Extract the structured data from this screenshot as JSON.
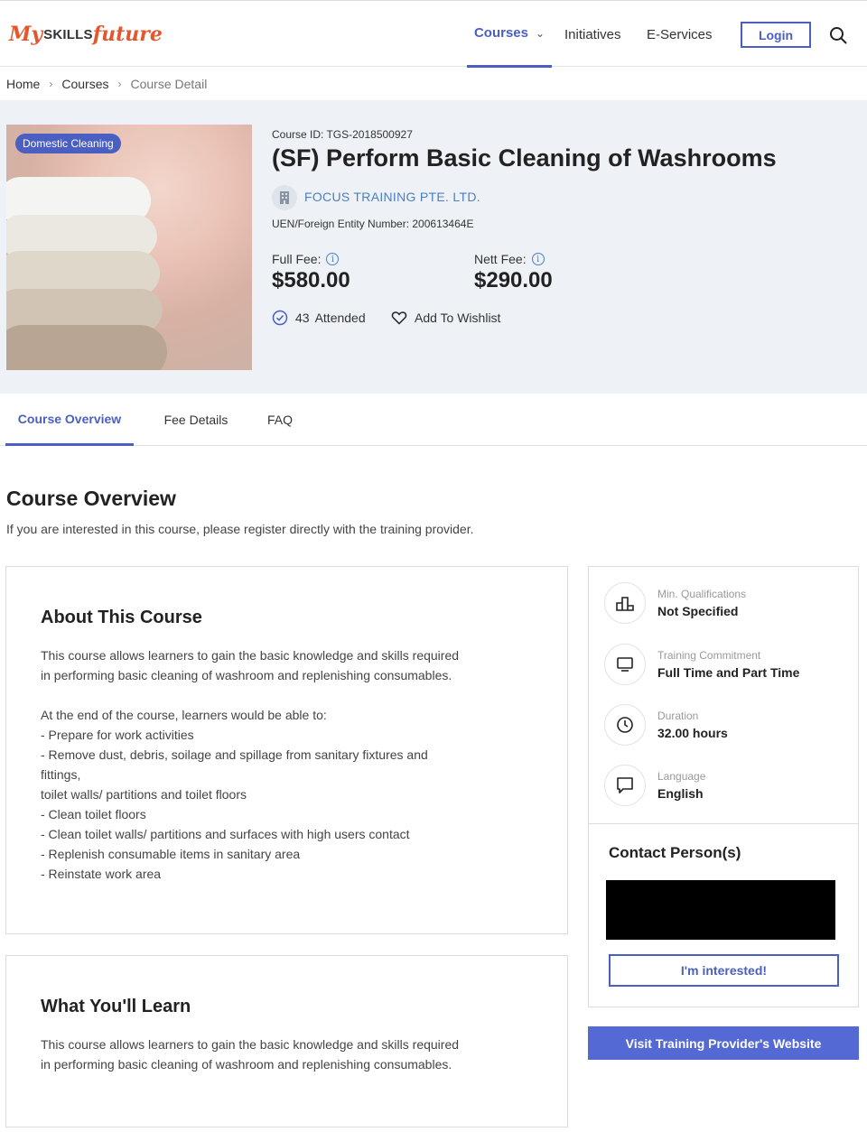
{
  "header": {
    "logo": {
      "my": "My",
      "skills": "SKILLS",
      "future": "future"
    },
    "nav": {
      "courses": "Courses",
      "initiatives": "Initiatives",
      "eservices": "E-Services"
    },
    "login": "Login"
  },
  "breadcrumb": {
    "home": "Home",
    "courses": "Courses",
    "current": "Course Detail"
  },
  "course": {
    "category": "Domestic Cleaning",
    "id_line": "Course ID: TGS-2018500927",
    "title": "(SF) Perform Basic Cleaning of Washrooms",
    "provider": "FOCUS TRAINING PTE. LTD.",
    "uen_line": "UEN/Foreign Entity Number: 200613464E",
    "full_fee_label": "Full Fee:",
    "full_fee": "$580.00",
    "nett_fee_label": "Nett Fee:",
    "nett_fee": "$290.00",
    "attended_count": "43",
    "attended_label": "Attended",
    "wishlist_label": "Add To Wishlist"
  },
  "tabs": {
    "overview": "Course Overview",
    "fee": "Fee Details",
    "faq": "FAQ"
  },
  "overview": {
    "title": "Course Overview",
    "subtitle": "If you are interested in this course, please register directly with the training provider.",
    "about_title": "About This Course",
    "about_body": "This course allows learners to gain the basic knowledge and skills required\nin performing basic cleaning of washroom and replenishing consumables.\n\nAt the end of the course, learners would be able to:\n- Prepare for work activities\n- Remove dust, debris, soilage and spillage from sanitary fixtures and\nfittings,\n   toilet walls/ partitions and toilet floors\n- Clean toilet floors\n- Clean toilet walls/ partitions and surfaces with high users contact\n- Replenish consumable items in sanitary area\n- Reinstate work area",
    "learn_title": "What You'll Learn",
    "learn_body": "This course allows learners to gain the basic knowledge and skills required\nin performing basic cleaning of washroom and replenishing consumables."
  },
  "sidebar": {
    "qualifications_label": "Min. Qualifications",
    "qualifications_value": "Not Specified",
    "commitment_label": "Training Commitment",
    "commitment_value": "Full Time and Part Time",
    "duration_label": "Duration",
    "duration_value": "32.00 hours",
    "language_label": "Language",
    "language_value": "English",
    "contact_title": "Contact Person(s)",
    "interested_button": "I'm interested!",
    "visit_button": "Visit Training Provider's Website"
  },
  "colors": {
    "accent": "#4a5fc1",
    "link": "#4a7fc1",
    "logo": "#e4572e",
    "hero_bg": "#eef2f7"
  }
}
